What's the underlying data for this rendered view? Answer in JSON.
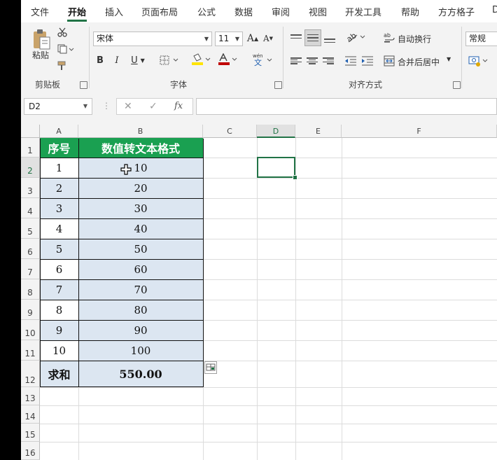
{
  "menu": {
    "tabs": [
      "文件",
      "开始",
      "插入",
      "页面布局",
      "公式",
      "数据",
      "审阅",
      "视图",
      "开发工具",
      "帮助",
      "方方格子",
      "D"
    ],
    "active_tab": "开始"
  },
  "ribbon": {
    "clipboard": {
      "paste_label": "粘贴",
      "group_label": "剪贴板"
    },
    "font": {
      "font_name": "宋体",
      "font_size": "11",
      "bold": "B",
      "italic": "I",
      "underline": "U",
      "grow": "A",
      "shrink": "A",
      "group_label": "字体"
    },
    "alignment": {
      "wrap_text": "自动换行",
      "merge_center": "合并后居中",
      "group_label": "对齐方式"
    },
    "number": {
      "format": "常规"
    }
  },
  "formula_bar": {
    "name_box": "D2",
    "formula": "",
    "fx": "fx"
  },
  "grid": {
    "columns": [
      "A",
      "B",
      "C",
      "D",
      "E",
      "F"
    ],
    "selected_column": "D",
    "selected_row": "2",
    "rows": [
      "1",
      "2",
      "3",
      "4",
      "5",
      "6",
      "7",
      "8",
      "9",
      "10",
      "11",
      "12",
      "13",
      "14",
      "15",
      "16"
    ]
  },
  "table": {
    "headers": [
      "序号",
      "数值转文本格式"
    ],
    "rows": [
      {
        "seq": "1",
        "value": "10"
      },
      {
        "seq": "2",
        "value": "20"
      },
      {
        "seq": "3",
        "value": "30"
      },
      {
        "seq": "4",
        "value": "40"
      },
      {
        "seq": "5",
        "value": "50"
      },
      {
        "seq": "6",
        "value": "60"
      },
      {
        "seq": "7",
        "value": "70"
      },
      {
        "seq": "8",
        "value": "80"
      },
      {
        "seq": "9",
        "value": "90"
      },
      {
        "seq": "10",
        "value": "100"
      }
    ],
    "sum_label": "求和",
    "sum_value": "550.00"
  },
  "colors": {
    "header_green": "#1aa051",
    "stripe_blue": "#dce6f1",
    "excel_green": "#217346"
  }
}
